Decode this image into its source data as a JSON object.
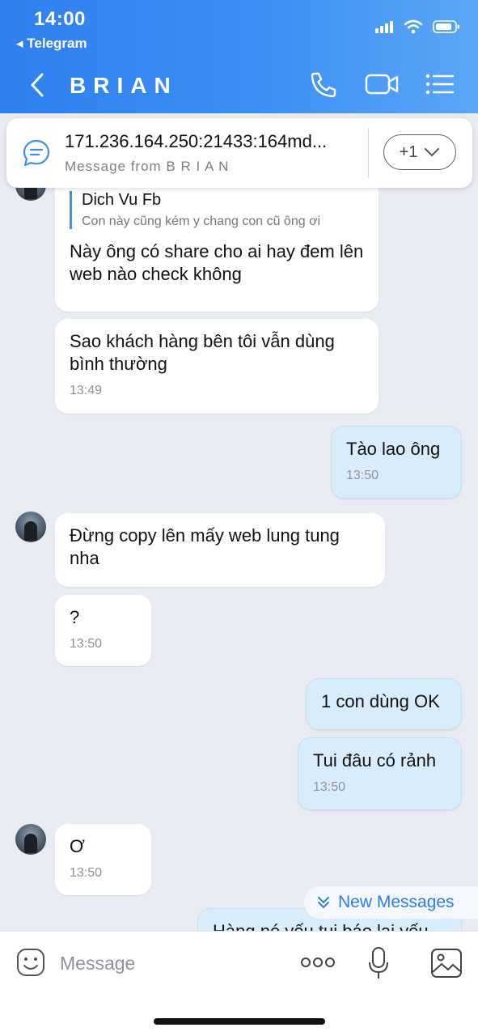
{
  "status_bar": {
    "time": "14:00",
    "back_app": "Telegram"
  },
  "header": {
    "title": "BRIAN"
  },
  "pinned": {
    "title": "171.236.164.250:21433:164md...",
    "subtitle": "Message from B R I A N",
    "count": "+1"
  },
  "messages": [
    {
      "reply_author": "Dich Vu Fb",
      "reply_text": "Con này cũng kém y chang con cũ ông ơi",
      "text": "Này ông có share cho ai hay đem lên web nào check không"
    },
    {
      "text": "Sao khách hàng bên tôi vẫn dùng bình thường",
      "time": "13:49"
    },
    {
      "text": "Tào lao ông",
      "time": "13:50"
    },
    {
      "text": "Đừng copy lên mấy web lung tung nha"
    },
    {
      "text": "?",
      "time": "13:50"
    },
    {
      "text": "1 con dùng OK"
    },
    {
      "text": "Tui đâu có rảnh",
      "time": "13:50"
    },
    {
      "text": "Ơ",
      "time": "13:50"
    },
    {
      "text": "Hàng nó yếu tui báo lại yếu"
    }
  ],
  "new_messages_label": "New Messages",
  "input": {
    "placeholder": "Message"
  },
  "colors": {
    "header": "#3d8ff4",
    "outgoing_bubble": "#d9ecfb",
    "background": "#e8ebf2"
  }
}
